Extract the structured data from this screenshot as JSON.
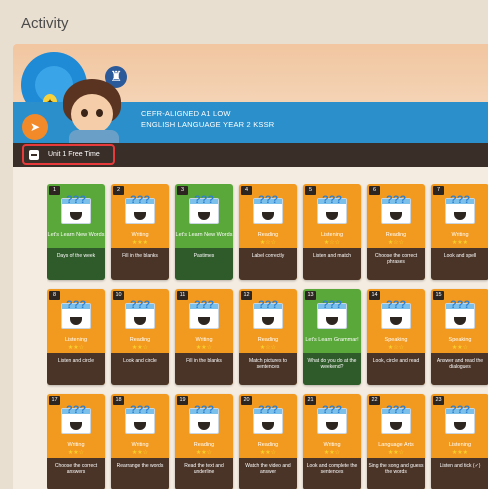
{
  "page": {
    "title": "Activity"
  },
  "banner": {
    "line1": "CEFR-ALIGNED A1 LOW",
    "line2": "ENGLISH LANGUAGE YEAR 2 KSSR"
  },
  "unit": {
    "label": "Unit 1 Free Time"
  },
  "cards": [
    {
      "num": "1",
      "type": "Let's Learn New Words",
      "stars": "",
      "desc": "Days of the week",
      "color": "green"
    },
    {
      "num": "2",
      "type": "Writing",
      "stars": "★★★",
      "desc": "Fill in the blanks",
      "color": "orange"
    },
    {
      "num": "3",
      "type": "Let's Learn New Words",
      "stars": "",
      "desc": "Pastimes",
      "color": "green"
    },
    {
      "num": "4",
      "type": "Reading",
      "stars": "★☆☆",
      "desc": "Label correctly",
      "color": "orange"
    },
    {
      "num": "5",
      "type": "Listening",
      "stars": "★☆☆",
      "desc": "Listen and match",
      "color": "orange"
    },
    {
      "num": "6",
      "type": "Reading",
      "stars": "★☆☆",
      "desc": "Choose the correct phrases",
      "color": "orange"
    },
    {
      "num": "7",
      "type": "Writing",
      "stars": "★★★",
      "desc": "Look and spell",
      "color": "orange"
    },
    {
      "num": "8",
      "type": "Listening",
      "stars": "★★☆",
      "desc": "Listen and circle",
      "color": "orange"
    },
    {
      "num": "10",
      "type": "Reading",
      "stars": "★★☆",
      "desc": "Look and circle",
      "color": "orange"
    },
    {
      "num": "11",
      "type": "Writing",
      "stars": "★★☆",
      "desc": "Fill in the blanks",
      "color": "orange"
    },
    {
      "num": "12",
      "type": "Reading",
      "stars": "★☆☆",
      "desc": "Match pictures to sentences",
      "color": "orange"
    },
    {
      "num": "13",
      "type": "Let's Learn Grammar!",
      "stars": "",
      "desc": "What do you do at the weekend?",
      "color": "green"
    },
    {
      "num": "14",
      "type": "Speaking",
      "stars": "★☆☆",
      "desc": "Look, circle and read",
      "color": "orange"
    },
    {
      "num": "15",
      "type": "Speaking",
      "stars": "★★☆",
      "desc": "Answer and read the dialogues",
      "color": "orange"
    },
    {
      "num": "17",
      "type": "Writing",
      "stars": "★★☆",
      "desc": "Choose the correct answers",
      "color": "orange"
    },
    {
      "num": "18",
      "type": "Writing",
      "stars": "★★☆",
      "desc": "Rearrange the words",
      "color": "orange"
    },
    {
      "num": "19",
      "type": "Reading",
      "stars": "★★☆",
      "desc": "Read the text and underline",
      "color": "orange"
    },
    {
      "num": "20",
      "type": "Reading",
      "stars": "★★☆",
      "desc": "Watch the video and answer",
      "color": "orange"
    },
    {
      "num": "21",
      "type": "Writing",
      "stars": "★★☆",
      "desc": "Look and complete the sentences",
      "color": "orange"
    },
    {
      "num": "22",
      "type": "Language Arts",
      "stars": "★★☆",
      "desc": "Sing the song and guess the words",
      "color": "orange"
    },
    {
      "num": "23",
      "type": "Listening",
      "stars": "★★★",
      "desc": "Listen and tick (✓)",
      "color": "orange"
    }
  ]
}
